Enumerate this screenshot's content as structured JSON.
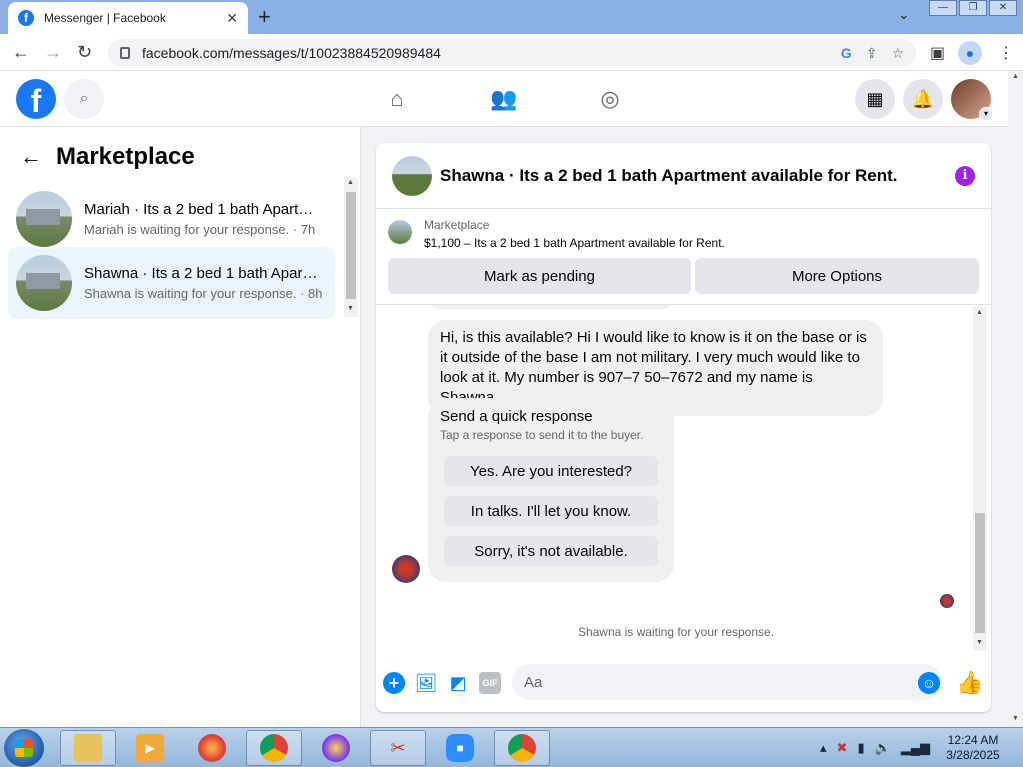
{
  "browser": {
    "tab_title": "Messenger | Facebook",
    "tab_close": "✕",
    "new_tab": "+",
    "url": "facebook.com/messages/t/10023884520989484"
  },
  "fb": {
    "logo": "f"
  },
  "sidebar": {
    "title": "Marketplace",
    "conversations": [
      {
        "name": "Mariah · Its a 2 bed 1 bath Apartment available for Rent.",
        "subtitle": "Mariah is waiting for your response. · 7h"
      },
      {
        "name": "Shawna · Its a 2 bed 1 bath Apartment available for Rent.",
        "subtitle": "Shawna is waiting for your response. · 8h"
      }
    ]
  },
  "chat": {
    "title": "Shawna · Its a 2 bed 1 bath Apartment available for Rent.",
    "info": "i",
    "listing": {
      "label": "Marketplace",
      "description": "$1,100 – Its a 2 bed 1 bath Apartment available for Rent."
    },
    "buttons": {
      "mark_pending": "Mark as pending",
      "more_options": "More Options"
    },
    "message": "Hi, is this available? Hi I would like to know is it on the base or is it outside of the base I am not military. I very much would like to look at it. My number is 907–7 50–7672 and my name is Shawna.",
    "quick_response": {
      "title": "Send a quick response",
      "subtitle": "Tap a response to send it to the buyer.",
      "options": [
        "Yes. Are you interested?",
        "In talks. I'll let you know.",
        "Sorry, it's not available."
      ]
    },
    "waiting": "Shawna is waiting for your response.",
    "composer": {
      "placeholder": "Aa",
      "gif": "GIF"
    }
  },
  "taskbar": {
    "time": "12:24 AM",
    "date": "3/28/2025"
  },
  "colors": {
    "fb_blue": "#1877f2",
    "messenger_blue": "#0084ff",
    "active_conv": "#ebf5ff",
    "info_purple": "#a020f0"
  }
}
